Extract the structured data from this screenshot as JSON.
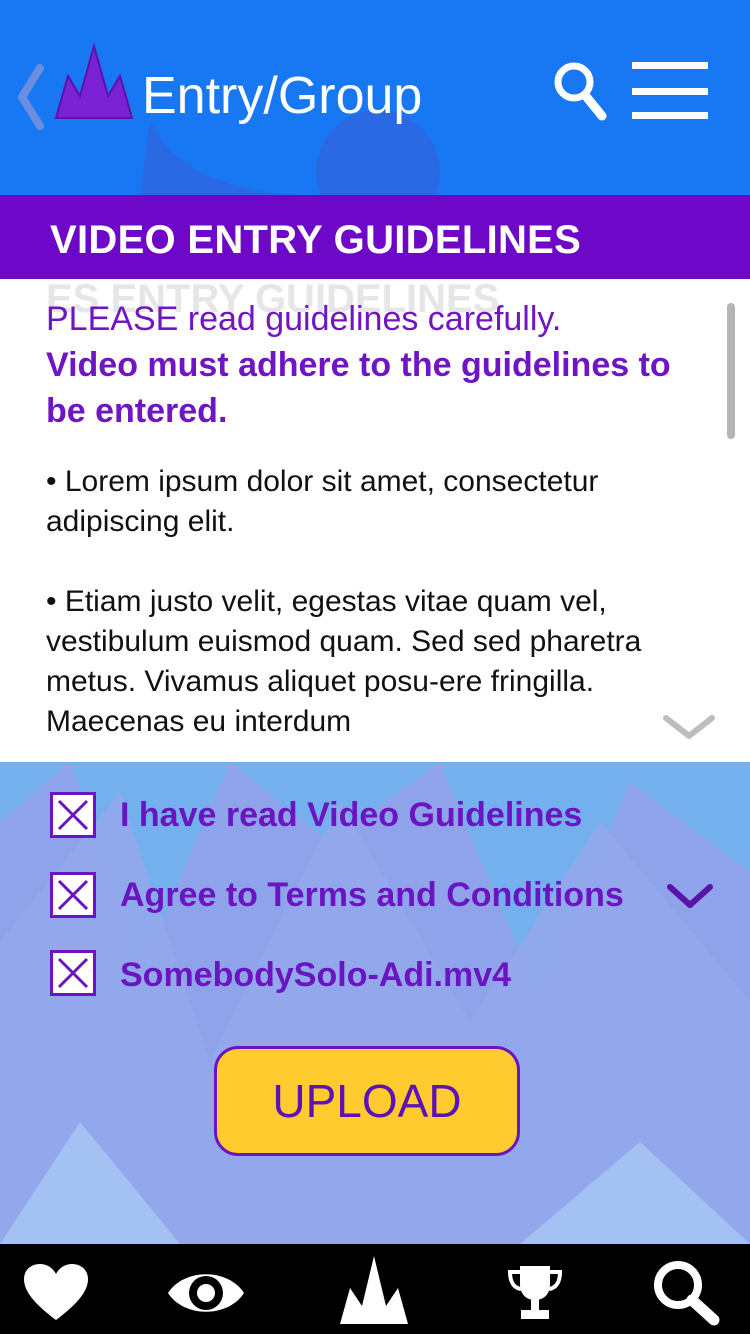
{
  "header": {
    "title": "Entry/Group"
  },
  "section": {
    "title": "VIDEO ENTRY GUIDELINES",
    "ghost_text": "ES ENTRY GUIDELINES"
  },
  "guidelines": {
    "intro": "PLEASE read guidelines carefully.",
    "emphasis": "Video must adhere to the guidelines to be entered.",
    "bullets": [
      "• Lorem ipsum dolor sit amet, consectetur adipiscing elit.",
      "• Etiam justo velit, egestas vitae quam vel, vestibulum euismod quam. Sed sed pharetra metus. Vivamus aliquet posu-ere fringilla. Maecenas eu interdum"
    ]
  },
  "checklist": [
    {
      "label": "I have read Video Guidelines",
      "checked": true
    },
    {
      "label": "Agree to Terms and Conditions",
      "checked": true
    },
    {
      "label": "SomebodySolo-Adi.mv4",
      "checked": true
    }
  ],
  "upload_label": "UPLOAD",
  "bottom_nav": [
    "heart-icon",
    "eye-icon",
    "crown-logo-icon",
    "trophy-icon",
    "search-icon"
  ],
  "colors": {
    "header_blue": "#1877f2",
    "section_purple": "#6d08c8",
    "text_purple": "#7015c4",
    "upload_yellow": "#ffcb2e",
    "nav_black": "#000000"
  }
}
